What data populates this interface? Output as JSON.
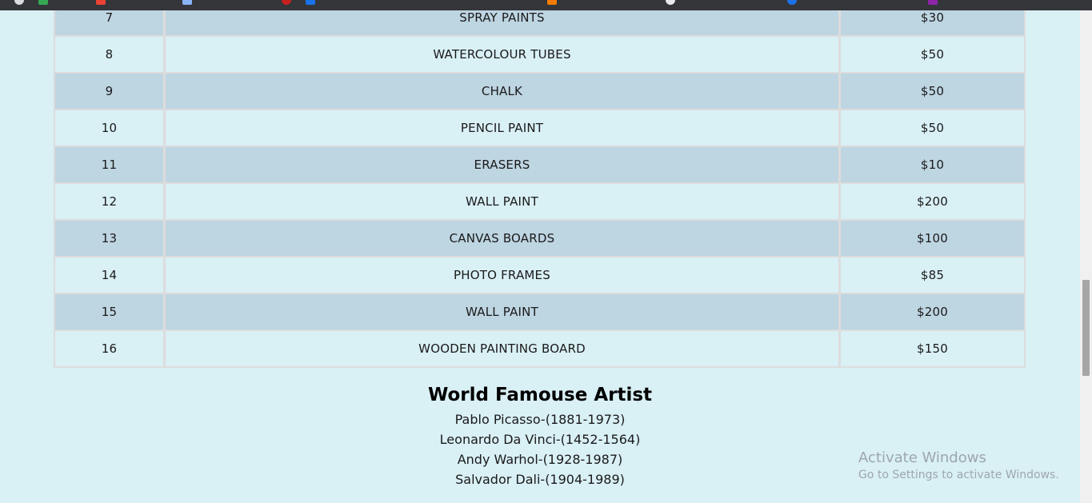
{
  "table": {
    "rows": [
      {
        "num": "7",
        "item": "SPRAY PAINTS",
        "price": "$30"
      },
      {
        "num": "8",
        "item": "WATERCOLOUR TUBES",
        "price": "$50"
      },
      {
        "num": "9",
        "item": "CHALK",
        "price": "$50"
      },
      {
        "num": "10",
        "item": "PENCIL PAINT",
        "price": "$50"
      },
      {
        "num": "11",
        "item": "ERASERS",
        "price": "$10"
      },
      {
        "num": "12",
        "item": "WALL PAINT",
        "price": "$200"
      },
      {
        "num": "13",
        "item": "CANVAS BOARDS",
        "price": "$100"
      },
      {
        "num": "14",
        "item": "PHOTO FRAMES",
        "price": "$85"
      },
      {
        "num": "15",
        "item": "WALL PAINT",
        "price": "$200"
      },
      {
        "num": "16",
        "item": "WOODEN PAINTING BOARD",
        "price": "$150"
      }
    ]
  },
  "artists": {
    "heading": "World Famouse Artist",
    "list": [
      "Pablo Picasso-(1881-1973)",
      "Leonardo Da Vinci-(1452-1564)",
      "Andy Warhol-(1928-1987)",
      "Salvador Dali-(1904-1989)"
    ]
  },
  "watermark": {
    "title": "Activate Windows",
    "subtitle": "Go to Settings to activate Windows."
  },
  "colors": {
    "page_background": "#d9f0f5",
    "row_shade": "#bed5e2",
    "border": "#dcdcdc"
  }
}
